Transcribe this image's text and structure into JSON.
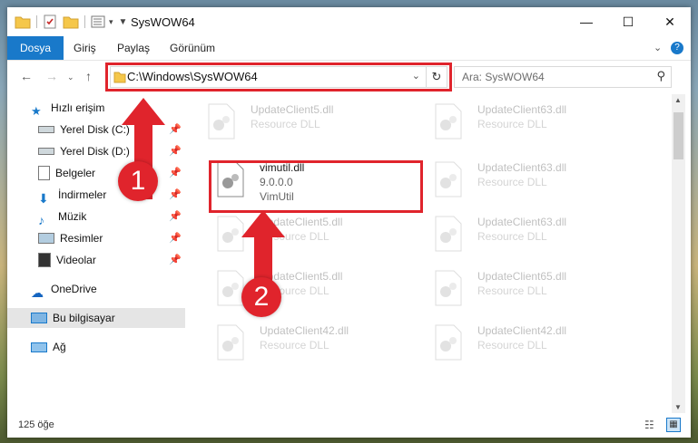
{
  "window": {
    "title": "SysWOW64"
  },
  "ribbon": {
    "tabs": [
      "Dosya",
      "Giriş",
      "Paylaş",
      "Görünüm"
    ]
  },
  "address": {
    "path": "C:\\Windows\\SysWOW64"
  },
  "search": {
    "placeholder": "Ara: SysWOW64"
  },
  "nav": {
    "quick_access": "Hızlı erişim",
    "items": [
      "Yerel Disk (C:)",
      "Yerel Disk (D:)",
      "Belgeler",
      "İndirmeler",
      "Müzik",
      "Resimler",
      "Videolar"
    ],
    "onedrive": "OneDrive",
    "this_pc": "Bu bilgisayar",
    "network": "Ağ"
  },
  "files": {
    "highlighted": {
      "name": "vimutil.dll",
      "version": "9.0.0.0",
      "desc": "VimUtil"
    },
    "faded": [
      {
        "name": "UpdateClient5.dll",
        "desc": "Resource DLL"
      },
      {
        "name": "UpdateClient63.dll",
        "desc": "Resource DLL"
      },
      {
        "name": "UpdateClient63.dll",
        "desc": "Resource DLL"
      },
      {
        "name": "UpdateClient5.dll",
        "desc": "Resource DLL"
      },
      {
        "name": "UpdateClient63.dll",
        "desc": "Resource DLL"
      },
      {
        "name": "UpdateClient5.dll",
        "desc": "Resource DLL"
      },
      {
        "name": "UpdateClient65.dll",
        "desc": "Resource DLL"
      },
      {
        "name": "UpdateClient42.dll",
        "desc": "Resource DLL"
      },
      {
        "name": "UpdateClient42.dll",
        "desc": "Resource DLL"
      }
    ]
  },
  "status": {
    "count": "125 öğe"
  },
  "annotations": {
    "step1": "1",
    "step2": "2"
  },
  "colors": {
    "accent": "#1979ca",
    "highlight": "#e0242c"
  }
}
